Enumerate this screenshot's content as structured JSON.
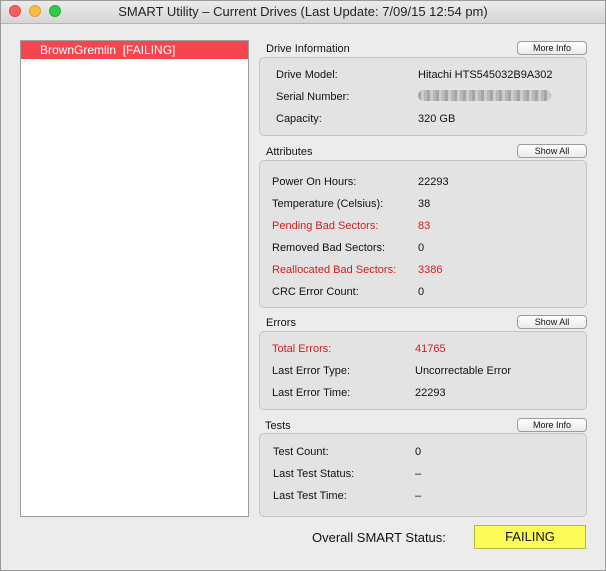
{
  "window": {
    "title": "SMART Utility – Current Drives (Last Update: 7/09/15 12:54 pm)"
  },
  "drives": [
    {
      "label": "BrownGremlin  [FAILING]"
    }
  ],
  "drive_information": {
    "title": "Drive Information",
    "button": "More Info",
    "rows": [
      {
        "label": "Drive Model:",
        "value": "Hitachi HTS545032B9A302"
      },
      {
        "label": "Serial Number:",
        "value": ""
      },
      {
        "label": "Capacity:",
        "value": "320 GB"
      }
    ]
  },
  "attributes": {
    "title": "Attributes",
    "button": "Show All",
    "rows": [
      {
        "label": "Power On Hours:",
        "value": "22293",
        "alert": false
      },
      {
        "label": "Temperature (Celsius):",
        "value": "38",
        "alert": false
      },
      {
        "label": "Pending Bad Sectors:",
        "value": "83",
        "alert": true
      },
      {
        "label": "Removed Bad Sectors:",
        "value": "0",
        "alert": false
      },
      {
        "label": "Reallocated Bad Sectors:",
        "value": "3386",
        "alert": true
      },
      {
        "label": "CRC Error Count:",
        "value": "0",
        "alert": false
      }
    ]
  },
  "errors": {
    "title": "Errors",
    "button": "Show All",
    "rows": [
      {
        "label": "Total Errors:",
        "value": "41765",
        "alert": true
      },
      {
        "label": "Last Error Type:",
        "value": "Uncorrectable Error",
        "alert": false
      },
      {
        "label": "Last Error Time:",
        "value": "22293",
        "alert": false
      }
    ]
  },
  "tests": {
    "title": "Tests",
    "button": "More Info",
    "rows": [
      {
        "label": "Test Count:",
        "value": "0"
      },
      {
        "label": "Last Test Status:",
        "value": "–"
      },
      {
        "label": "Last Test Time:",
        "value": "–"
      }
    ]
  },
  "overall": {
    "label": "Overall SMART Status:",
    "status": "FAILING"
  },
  "colors": {
    "alert_text": "#d21d1d",
    "selection": "#f5454f",
    "status_highlight": "#fcfc58"
  }
}
